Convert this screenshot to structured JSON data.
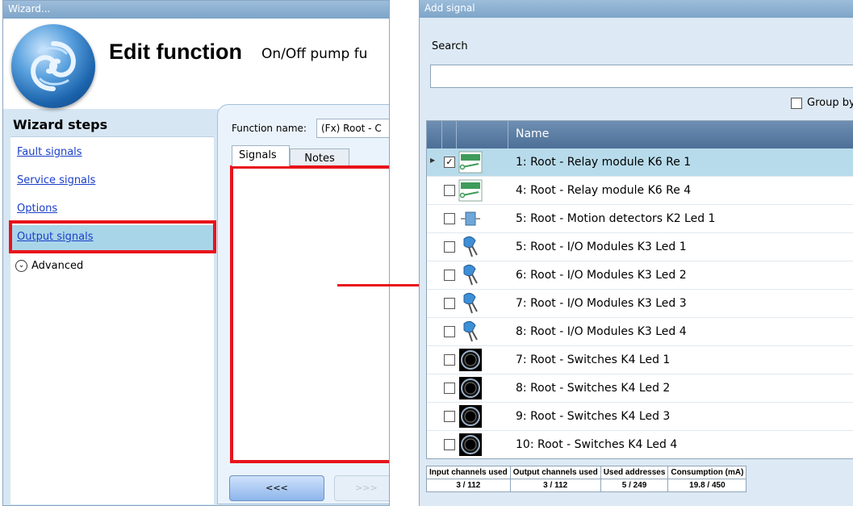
{
  "wizard": {
    "window_title": "Wizard...",
    "title": "Edit function",
    "subtitle": "On/Off pump fu",
    "steps_heading": "Wizard steps",
    "steps": [
      {
        "label": "Fault signals"
      },
      {
        "label": "Service signals"
      },
      {
        "label": "Options"
      },
      {
        "label": "Output signals",
        "active": true
      }
    ],
    "advanced_label": "Advanced",
    "function_name_label": "Function name:",
    "function_name_value": "(Fx) Root - C",
    "tabs": [
      {
        "label": "Signals",
        "selected": true
      },
      {
        "label": "Notes",
        "selected": false
      }
    ],
    "back_button": "<<<",
    "next_button": ">>>"
  },
  "add_signal": {
    "window_title": "Add signal",
    "search_label": "Search",
    "search_value": "",
    "group_by_label": "Group by",
    "column_name": "Name",
    "rows": [
      {
        "label": "1: Root - Relay module K6 Re 1",
        "checked": true,
        "selected": true,
        "icon": "relay-icon"
      },
      {
        "label": "4: Root - Relay module K6 Re 4",
        "checked": false,
        "selected": false,
        "icon": "relay-icon"
      },
      {
        "label": "5: Root - Motion detectors K2 Led 1",
        "checked": false,
        "selected": false,
        "icon": "motion-detector-icon"
      },
      {
        "label": "5: Root - I/O Modules K3 Led 1",
        "checked": false,
        "selected": false,
        "icon": "led-icon"
      },
      {
        "label": "6: Root - I/O Modules K3 Led 2",
        "checked": false,
        "selected": false,
        "icon": "led-icon"
      },
      {
        "label": "7: Root - I/O Modules K3 Led 3",
        "checked": false,
        "selected": false,
        "icon": "led-icon"
      },
      {
        "label": "8: Root - I/O Modules K3 Led 4",
        "checked": false,
        "selected": false,
        "icon": "led-icon"
      },
      {
        "label": "7: Root - Switches K4 Led 1",
        "checked": false,
        "selected": false,
        "icon": "switch-icon"
      },
      {
        "label": "8: Root - Switches K4 Led 2",
        "checked": false,
        "selected": false,
        "icon": "switch-icon"
      },
      {
        "label": "9: Root - Switches K4 Led 3",
        "checked": false,
        "selected": false,
        "icon": "switch-icon"
      },
      {
        "label": "10: Root - Switches K4 Led 4",
        "checked": false,
        "selected": false,
        "icon": "switch-icon"
      }
    ],
    "stats": [
      {
        "header": "Input channels used",
        "value": "3 / 112"
      },
      {
        "header": "Output channels used",
        "value": "3 / 112"
      },
      {
        "header": "Used addresses",
        "value": "5 / 249"
      },
      {
        "header": "Consumption (mA)",
        "value": "19.8 / 450"
      }
    ]
  },
  "colors": {
    "highlight_red": "#e8131b",
    "selected_row": "#b8dbeb",
    "active_step": "#a9d5e9",
    "grid_header": "#5a7ca4"
  }
}
